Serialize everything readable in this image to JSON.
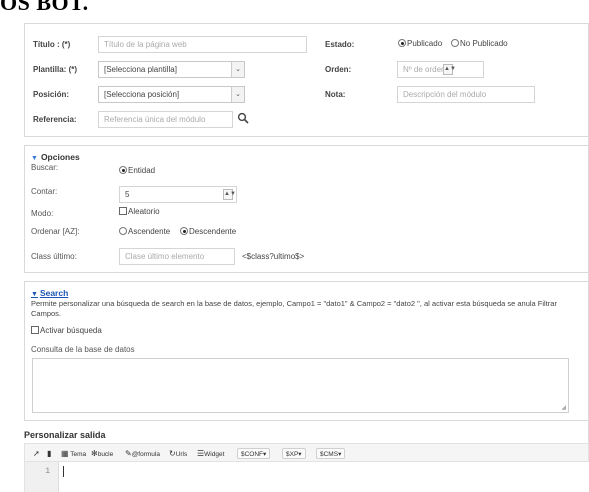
{
  "header": {
    "title": "OS BOT."
  },
  "form": {
    "titulo": {
      "label": "Título : (*)",
      "placeholder": "Título de la página web"
    },
    "plantilla": {
      "label": "Plantilla: (*)",
      "value": "[Selecciona plantilla]"
    },
    "posicion": {
      "label": "Posición:",
      "value": "[Selecciona posición]"
    },
    "referencia": {
      "label": "Referencia:",
      "placeholder": "Referencia única del módulo"
    },
    "estado": {
      "label": "Estado:",
      "options": [
        "Publicado",
        "No Publicado"
      ],
      "selected": "Publicado"
    },
    "orden": {
      "label": "Orden:",
      "placeholder": "Nº de orden"
    },
    "nota": {
      "label": "Nota:",
      "placeholder": "Descripción del módulo"
    }
  },
  "opciones": {
    "heading": "Opciones",
    "buscar": {
      "label": "Buscar:",
      "option": "Entidad"
    },
    "contar": {
      "label": "Contar:",
      "value": "5"
    },
    "modo": {
      "label": "Modo:",
      "option": "Aleatorio"
    },
    "ordenar": {
      "label": "Ordenar [AZ]:",
      "options": [
        "Ascendente",
        "Descendente"
      ],
      "selected": "Descendente"
    },
    "class_ultimo": {
      "label": "Class último:",
      "placeholder": "Clase último elemento",
      "hint": "<$class?ultimo$>"
    }
  },
  "search": {
    "heading": "Search",
    "description": "Permite personalizar una búsqueda de search en la base de datos, ejemplo, Campo1 = \"dato1\" & Campo2 = \"dato2 \", al activar esta búsqueda se anula Filtrar Campos.",
    "activar_label": "Activar búsqueda",
    "consulta_label": "Consulta de la base de datos"
  },
  "salida": {
    "heading": "Personalizar salida",
    "toolbar": {
      "tema": "Tema",
      "bucle": "bucle",
      "formula": "@formula",
      "urls": "Urls",
      "widget": "Widget",
      "conf": "$CONF",
      "xp": "$XP",
      "cms": "$CMS"
    },
    "editor": {
      "line_number": "1"
    }
  }
}
